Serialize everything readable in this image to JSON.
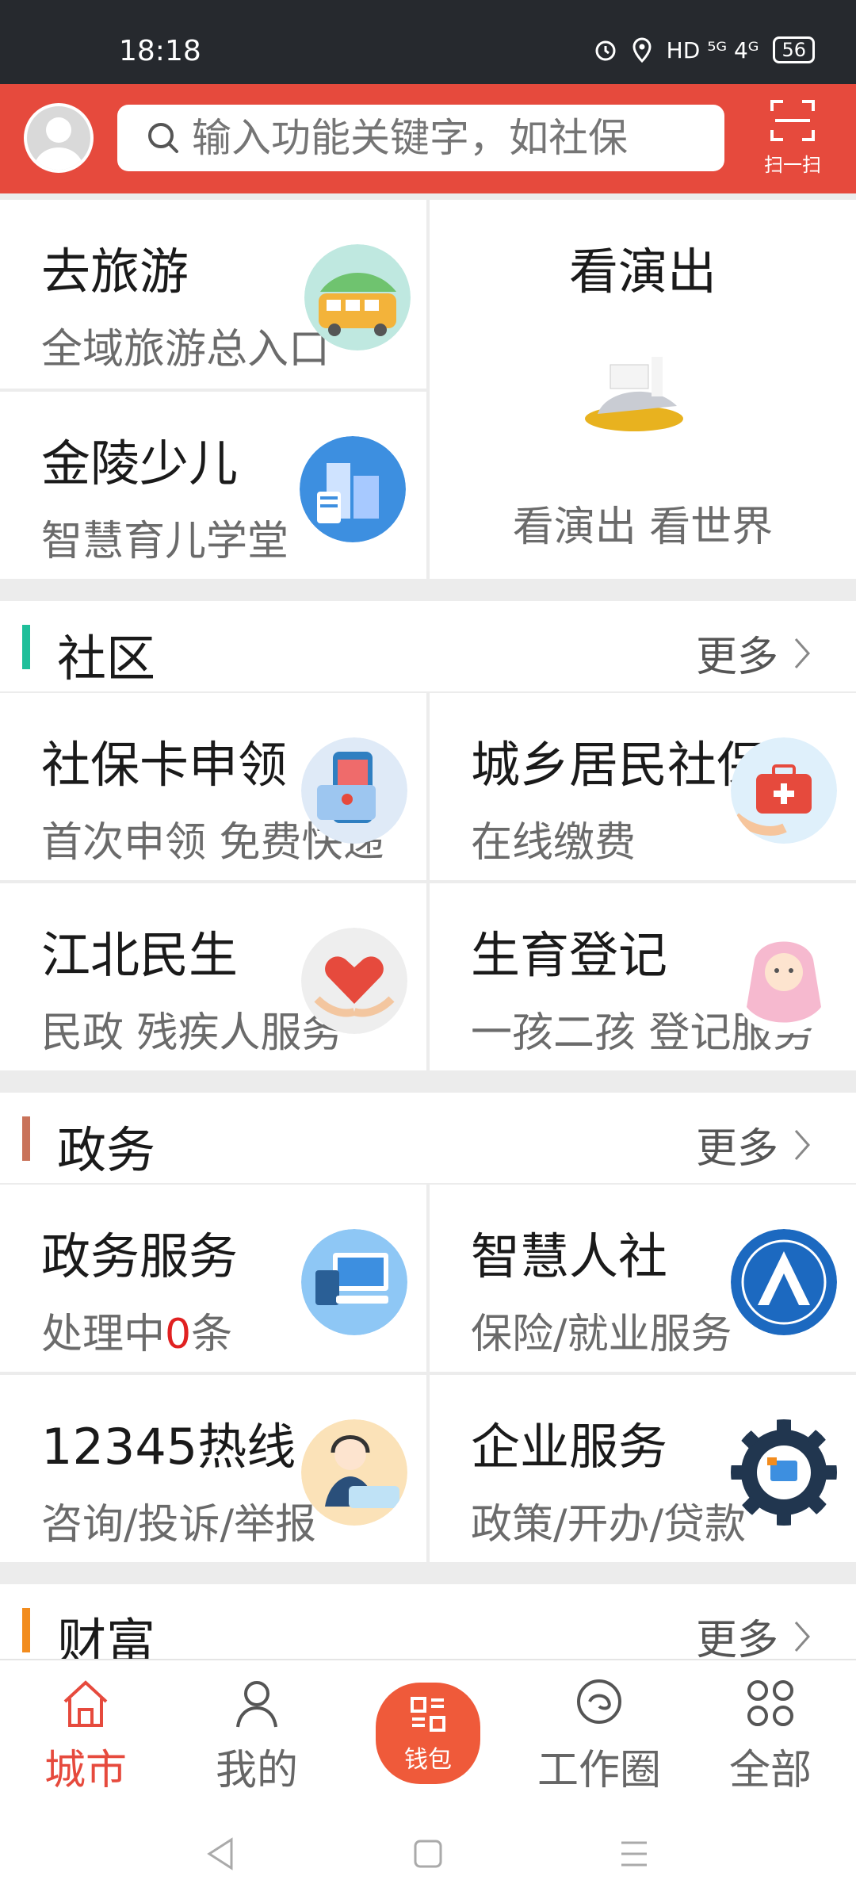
{
  "status_bar": {
    "time": "18:18",
    "network": "HD ⁵ᴳ 4ᴳ",
    "battery": "56"
  },
  "header": {
    "search_placeholder": "输入功能关键字，如社保",
    "scan_label": "扫一扫"
  },
  "top_cards": [
    {
      "title": "去旅游",
      "subtitle": "全域旅游总入口"
    },
    {
      "title": "看演出",
      "subtitle": "看演出  看世界"
    },
    {
      "title": "金陵少儿",
      "subtitle": "智慧育儿学堂"
    }
  ],
  "sections": [
    {
      "title": "社区",
      "more": "更多",
      "items": [
        {
          "title": "社保卡申领",
          "subtitle": "首次申领 免费快递"
        },
        {
          "title": "城乡居民社保",
          "subtitle": "在线缴费"
        },
        {
          "title": "江北民生",
          "subtitle": "民政  残疾人服务"
        },
        {
          "title": "生育登记",
          "subtitle": "一孩二孩 登记服务"
        }
      ]
    },
    {
      "title": "政务",
      "more": "更多",
      "items": [
        {
          "title": "政务服务",
          "subtitle_pre": "处理中",
          "subtitle_num": "0",
          "subtitle_post": "条"
        },
        {
          "title": "智慧人社",
          "subtitle": "保险/就业服务"
        },
        {
          "title": "12345热线",
          "subtitle": "咨询/投诉/举报"
        },
        {
          "title": "企业服务",
          "subtitle": "政策/开办/贷款"
        }
      ]
    },
    {
      "title": "财富",
      "more": "更多"
    }
  ],
  "bottom_nav": [
    {
      "label": "城市",
      "icon": "home-icon",
      "active": true
    },
    {
      "label": "我的",
      "icon": "person-icon"
    },
    {
      "label": "钱包",
      "icon": "wallet-qr-icon"
    },
    {
      "label": "工作圈",
      "icon": "chat-circle-icon"
    },
    {
      "label": "全部",
      "icon": "grid-icon"
    }
  ],
  "colors": {
    "brand": "#e64a3d",
    "community_bar": "#1fbf9a",
    "gov_bar": "#c9735a",
    "wealth_bar": "#f28c1e",
    "highlight_red": "#e02121"
  }
}
